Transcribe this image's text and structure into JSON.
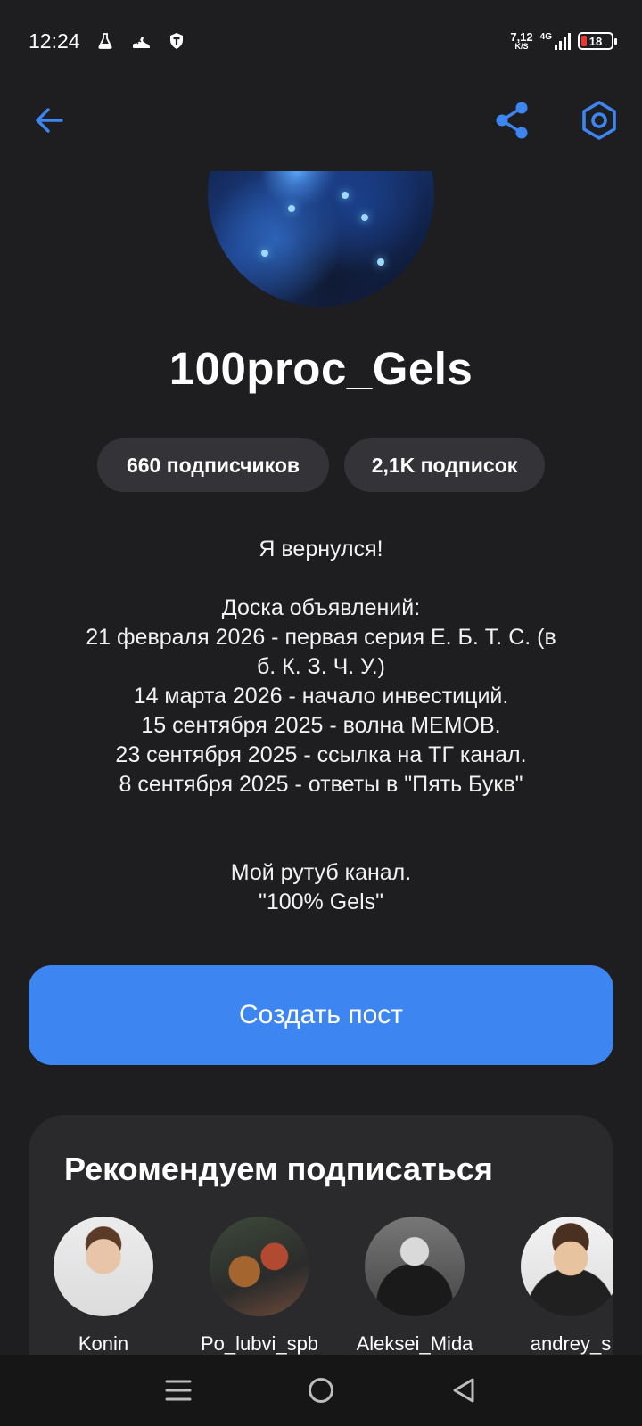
{
  "status_bar": {
    "time": "12:24",
    "net_speed_value": "7,12",
    "net_speed_unit": "K/S",
    "network_type": "4G",
    "battery_level": "18",
    "battery_fraction": 0.18
  },
  "header": {
    "back_icon": "arrow-left-icon",
    "share_icon": "share-icon",
    "settings_icon": "hexagon-settings-icon",
    "accent_color": "#3d86f2"
  },
  "profile": {
    "username": "100proc_Gels",
    "followers_label": "660 подписчиков",
    "following_label": "2,1K подписок",
    "bio": {
      "line1": "Я вернулся!",
      "line2": "Доска объявлений:",
      "line3": "21 февраля 2026 - первая серия Е. Б. Т. С. (в",
      "line4": "б. К. З. Ч. У.)",
      "line5": "14 марта 2026 - начало инвестиций.",
      "line6": "15 сентября 2025 - волна МЕМОВ.",
      "line7": "23 сентября 2025 - ссылка на ТГ канал.",
      "line8": "8 сентября 2025 - ответы в \"Пять Букв\"",
      "line9": "Мой рутуб канал.",
      "line10": "\"100% Gels\""
    }
  },
  "actions": {
    "create_post_label": "Создать пост"
  },
  "recommendations": {
    "title": "Рекомендуем подписаться",
    "users": [
      {
        "name": "Konin"
      },
      {
        "name": "Po_lubvi_spb"
      },
      {
        "name": "Aleksei_Mida"
      },
      {
        "name": "andrey_s"
      }
    ]
  },
  "navigation": {
    "menu_icon": "menu-icon",
    "home_icon": "home-circle-icon",
    "back_icon": "triangle-back-icon"
  }
}
